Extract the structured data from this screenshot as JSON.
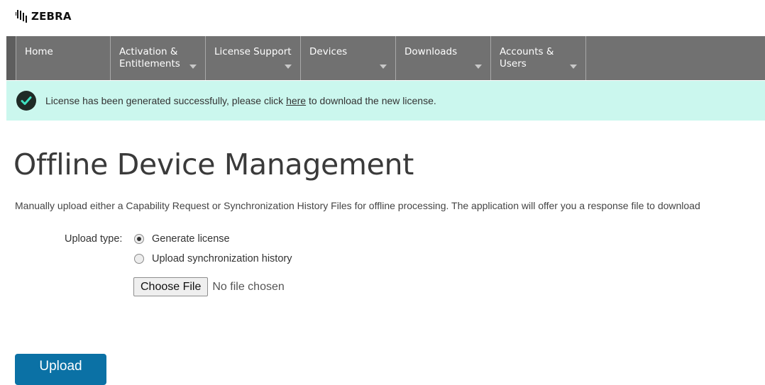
{
  "brand": {
    "name": "ZEBRA",
    "logo_icon": "zebra-head-icon"
  },
  "nav": {
    "items": [
      {
        "label": "Home",
        "has_dropdown": false
      },
      {
        "label": "Activation & Entitlements",
        "has_dropdown": true
      },
      {
        "label": "License Support",
        "has_dropdown": true
      },
      {
        "label": "Devices",
        "has_dropdown": true
      },
      {
        "label": "Downloads",
        "has_dropdown": true
      },
      {
        "label": "Accounts & Users",
        "has_dropdown": true
      }
    ]
  },
  "alert": {
    "icon": "check-circle-icon",
    "text_before": "License has been generated successfully, please click ",
    "link": "here",
    "text_after": " to download the new license.",
    "color": "#cbf7ee"
  },
  "page": {
    "title": "Offline Device Management",
    "description": "Manually upload either a Capability Request or Synchronization History Files for offline processing. The application will offer you a response file to download"
  },
  "form": {
    "upload_type_label": "Upload type:",
    "options": [
      {
        "label": "Generate license",
        "selected": true
      },
      {
        "label": "Upload synchronization history",
        "selected": false
      }
    ],
    "choose_file_label": "Choose File",
    "file_status": "No file chosen",
    "upload_label": "Upload"
  },
  "colors": {
    "nav_bg": "#717171",
    "accent_button": "#0b71a5"
  }
}
